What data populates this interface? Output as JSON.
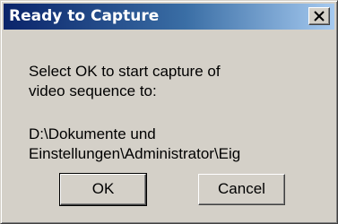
{
  "window": {
    "title": "Ready to Capture",
    "close_icon": "close-icon"
  },
  "message": {
    "line1": "Select OK to start capture of",
    "line2": "video sequence to:"
  },
  "path": {
    "line1": "D:\\Dokumente und",
    "line2": "Einstellungen\\Administrator\\Eig"
  },
  "buttons": {
    "ok_label": "OK",
    "cancel_label": "Cancel"
  },
  "colors": {
    "title_gradient_start": "#0a246a",
    "title_gradient_end": "#a6caf0",
    "dialog_background": "#d4d0c8"
  }
}
